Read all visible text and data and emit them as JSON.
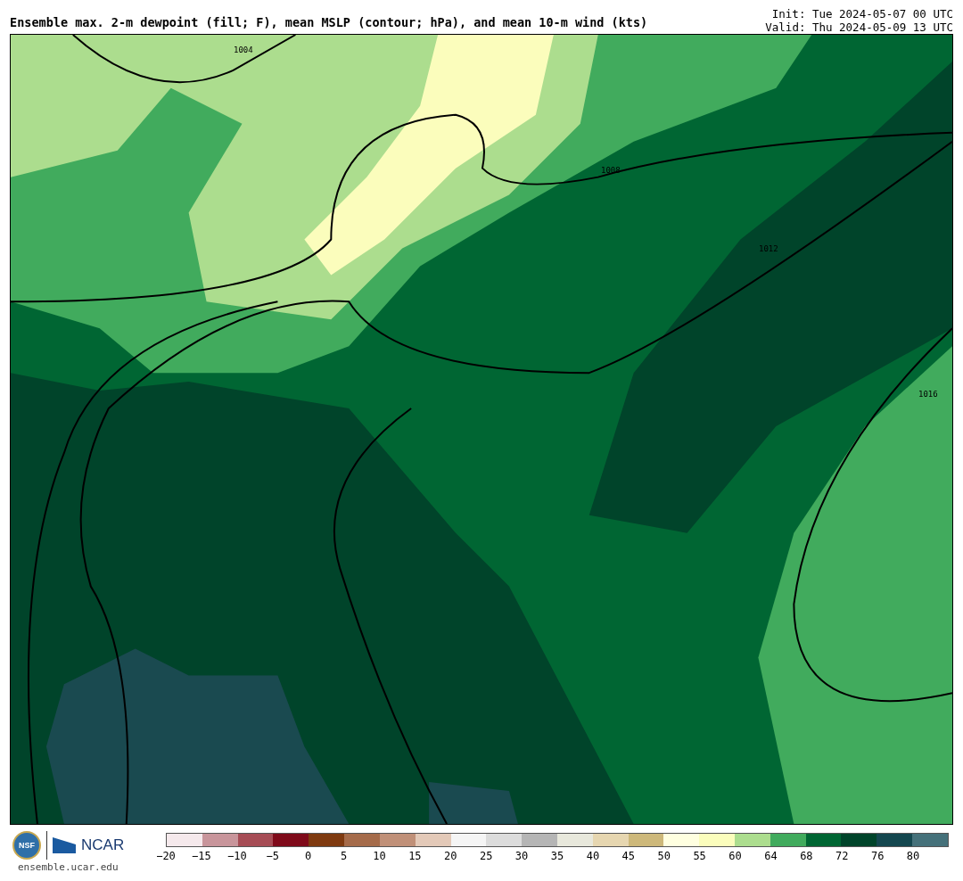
{
  "title": "Ensemble max. 2-m dewpoint (fill; F), mean MSLP (contour; hPa), and mean 10-m wind (kts)",
  "init": "Init: Tue 2024-05-07 00 UTC",
  "valid": "Valid: Thu 2024-05-09 13 UTC",
  "map": {
    "contour_labels": [
      "1004",
      "1008",
      "1012",
      "1016"
    ]
  },
  "colorbar": {
    "segments": [
      {
        "color": "#f5e9ec"
      },
      {
        "color": "#c8959b"
      },
      {
        "color": "#a64c55"
      },
      {
        "color": "#7f0a1a"
      },
      {
        "color": "#7f3a10"
      },
      {
        "color": "#a56b4a"
      },
      {
        "color": "#c09078"
      },
      {
        "color": "#e3c9b8"
      },
      {
        "color": "#f5f5f5"
      },
      {
        "color": "#dcdcdc"
      },
      {
        "color": "#b5b5b5"
      },
      {
        "color": "#e8e8dc"
      },
      {
        "color": "#e6d6b0"
      },
      {
        "color": "#cdb87a"
      },
      {
        "color": "#ffffe0"
      },
      {
        "color": "#fbfdbc"
      },
      {
        "color": "#acdd8e"
      },
      {
        "color": "#41ab5d"
      },
      {
        "color": "#006633"
      },
      {
        "color": "#00442a"
      },
      {
        "color": "#14474f"
      },
      {
        "color": "#45717a"
      }
    ],
    "ticks": [
      "−20",
      "−15",
      "−10",
      "−5",
      "0",
      "5",
      "10",
      "15",
      "20",
      "25",
      "30",
      "35",
      "40",
      "45",
      "50",
      "55",
      "60",
      "64",
      "68",
      "72",
      "76",
      "80"
    ]
  },
  "footer": {
    "seal_text": "NSF",
    "logo_text": "NCAR",
    "url": "ensemble.ucar.edu"
  }
}
